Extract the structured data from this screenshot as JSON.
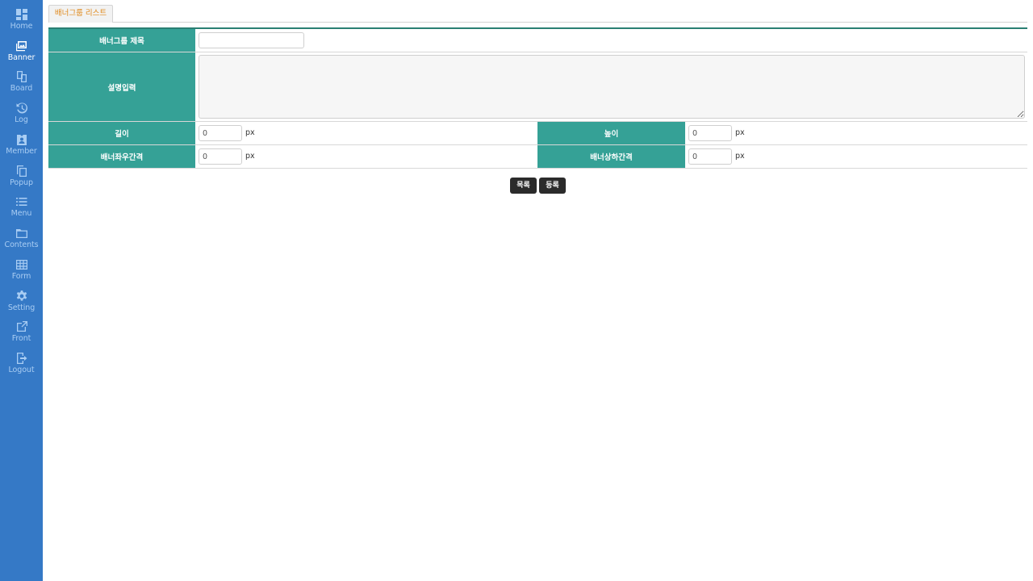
{
  "sidebar": {
    "items": [
      {
        "label": "Home",
        "icon": "dashboard-icon"
      },
      {
        "label": "Banner",
        "icon": "image-icon",
        "active": true
      },
      {
        "label": "Board",
        "icon": "board-icon"
      },
      {
        "label": "Log",
        "icon": "history-icon"
      },
      {
        "label": "Member",
        "icon": "member-badge-icon"
      },
      {
        "label": "Popup",
        "icon": "copy-icon"
      },
      {
        "label": "Menu",
        "icon": "list-icon"
      },
      {
        "label": "Contents",
        "icon": "folder-icon"
      },
      {
        "label": "Form",
        "icon": "table-icon"
      },
      {
        "label": "Setting",
        "icon": "gear-icon"
      },
      {
        "label": "Front",
        "icon": "external-link-icon"
      },
      {
        "label": "Logout",
        "icon": "logout-icon"
      }
    ]
  },
  "tabs": [
    {
      "label": "배너그룹 리스트"
    }
  ],
  "form": {
    "title_label": "배너그룹 제목",
    "title_value": "",
    "desc_label": "설명입력",
    "desc_value": "",
    "width_label": "길이",
    "width_value": "0",
    "height_label": "높이",
    "height_value": "0",
    "hgap_label": "배너좌우간격",
    "hgap_value": "0",
    "vgap_label": "배너상하간격",
    "vgap_value": "0",
    "unit": "px"
  },
  "buttons": {
    "list_label": "목록",
    "submit_label": "등록"
  },
  "colors": {
    "sidebar": "#3579c6",
    "label_bg": "#35a196",
    "tab_text": "#e08a1e",
    "button_bg": "#2b2b2b"
  }
}
